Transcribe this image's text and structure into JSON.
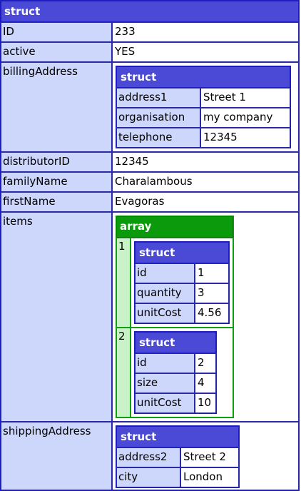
{
  "root": {
    "type_label": "struct",
    "fields": {
      "ID": {
        "key": "ID",
        "value": "233"
      },
      "active": {
        "key": "active",
        "value": "YES"
      },
      "billingAddress": {
        "key": "billingAddress",
        "struct_label": "struct",
        "rows": [
          {
            "key": "address1",
            "value": "Street 1"
          },
          {
            "key": "organisation",
            "value": "my company"
          },
          {
            "key": "telephone",
            "value": "12345"
          }
        ]
      },
      "distributorID": {
        "key": "distributorID",
        "value": "12345"
      },
      "familyName": {
        "key": "familyName",
        "value": "Charalambous"
      },
      "firstName": {
        "key": "firstName",
        "value": "Evagoras"
      },
      "items": {
        "key": "items",
        "array_label": "array",
        "elements": [
          {
            "index": "1",
            "struct_label": "struct",
            "rows": [
              {
                "key": "id",
                "value": "1"
              },
              {
                "key": "quantity",
                "value": "3"
              },
              {
                "key": "unitCost",
                "value": "4.56"
              }
            ]
          },
          {
            "index": "2",
            "struct_label": "struct",
            "rows": [
              {
                "key": "id",
                "value": "2"
              },
              {
                "key": "size",
                "value": "4"
              },
              {
                "key": "unitCost",
                "value": "10"
              }
            ]
          }
        ]
      },
      "shippingAddress": {
        "key": "shippingAddress",
        "struct_label": "struct",
        "rows": [
          {
            "key": "address2",
            "value": "Street 2"
          },
          {
            "key": "city",
            "value": "London"
          }
        ]
      }
    }
  },
  "colors": {
    "struct_header": "#4a4ad6",
    "struct_key_bg": "#cdd6fb",
    "struct_border": "#1c1cc0",
    "array_header": "#0b9a0b",
    "array_index_bg": "#c9f2c9"
  }
}
